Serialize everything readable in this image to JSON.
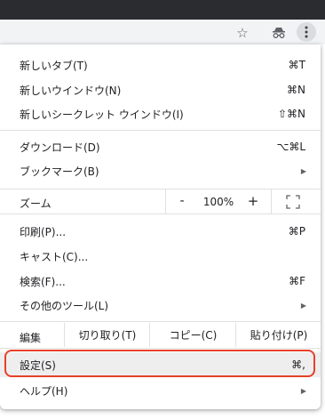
{
  "toolbar": {
    "icons": [
      "star-icon",
      "incognito-icon",
      "kebab-menu-icon"
    ]
  },
  "menu": {
    "new_tab": {
      "label": "新しいタブ(T)",
      "shortcut": "⌘T"
    },
    "new_window": {
      "label": "新しいウインドウ(N)",
      "shortcut": "⌘N"
    },
    "new_incognito": {
      "label": "新しいシークレット ウインドウ(I)",
      "shortcut": "⇧⌘N"
    },
    "downloads": {
      "label": "ダウンロード(D)",
      "shortcut": "⌥⌘L"
    },
    "bookmarks": {
      "label": "ブックマーク(B)"
    },
    "zoom": {
      "label": "ズーム",
      "minus": "-",
      "value": "100%",
      "plus": "+"
    },
    "print": {
      "label": "印刷(P)...",
      "shortcut": "⌘P"
    },
    "cast": {
      "label": "キャスト(C)..."
    },
    "find": {
      "label": "検索(F)...",
      "shortcut": "⌘F"
    },
    "more_tools": {
      "label": "その他のツール(L)"
    },
    "edit": {
      "label": "編集",
      "cut": "切り取り(T)",
      "copy": "コピー(C)",
      "paste": "貼り付け(P)"
    },
    "settings": {
      "label": "設定(S)",
      "shortcut": "⌘,"
    },
    "help": {
      "label": "ヘルプ(H)"
    }
  },
  "colors": {
    "highlight_ring": "#e6412a",
    "highlight_bg": "#eeeeee",
    "topbar": "#2b2c2f",
    "toolbar": "#f1f3f4"
  }
}
